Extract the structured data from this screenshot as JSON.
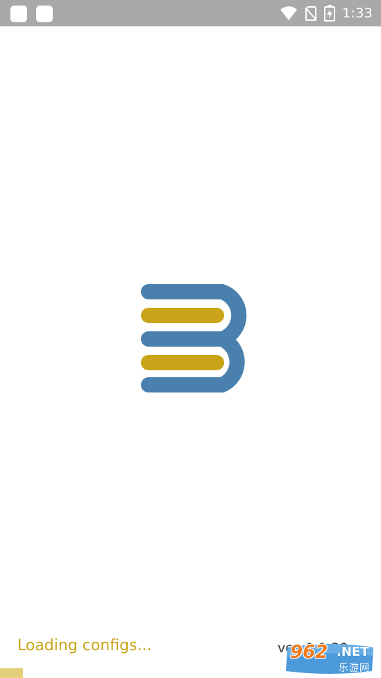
{
  "status_bar": {
    "time": "1:33",
    "icons": [
      "notification-icon",
      "notification-icon",
      "wifi-icon",
      "no-sim-icon",
      "battery-charging-icon"
    ]
  },
  "splash": {
    "logo_name": "app-logo-b",
    "logo_colors": {
      "outline": "#4a80ad",
      "bars": "#c9a418"
    }
  },
  "footer": {
    "loading_text": "Loading configs...",
    "version_text": "ver. 1.1.20",
    "progress": 0.06,
    "progress_color": "#e3cf7a"
  },
  "watermark": {
    "number": "962",
    "suffix": ".NET",
    "subtitle": "乐游网"
  }
}
